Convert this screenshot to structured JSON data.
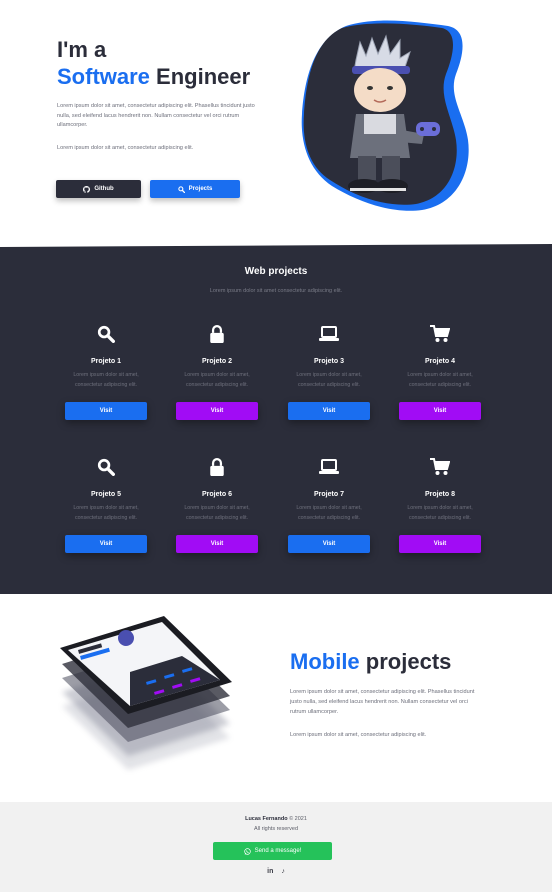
{
  "hero": {
    "title_line1": "I'm a",
    "title_accent": "Software",
    "title_rest": "Engineer",
    "paragraph1": "Lorem ipsum dolor sit amet, consectetur adipiscing elit. Phasellus tincidunt justo nulla, sed eleifend lacus hendrerit non. Nullam consectetur vel orci rutrum ullamcorper.",
    "paragraph2": "Lorem ipsum dolor sit amet, consectetur adipiscing elit.",
    "github_label": "Github",
    "projects_label": "Projects"
  },
  "web": {
    "title": "Web projects",
    "subtitle": "Lorem ipsum dolor sit amet consectetur adipiscing elit.",
    "cards": [
      {
        "name": "Projeto 1",
        "desc": "Lorem ipsum dolor sit amet, consectetur adipiscing elit.",
        "button": "Visit",
        "icon": "search-icon",
        "color": "#1a6ef0"
      },
      {
        "name": "Projeto 2",
        "desc": "Lorem ipsum dolor sit amet, consectetur adipiscing elit.",
        "button": "Visit",
        "icon": "lock-icon",
        "color": "#a10cf5"
      },
      {
        "name": "Projeto 3",
        "desc": "Lorem ipsum dolor sit amet, consectetur adipiscing elit.",
        "button": "Visit",
        "icon": "laptop-icon",
        "color": "#1a6ef0"
      },
      {
        "name": "Projeto 4",
        "desc": "Lorem ipsum dolor sit amet, consectetur adipiscing elit.",
        "button": "Visit",
        "icon": "cart-icon",
        "color": "#a10cf5"
      },
      {
        "name": "Projeto 5",
        "desc": "Lorem ipsum dolor sit amet, consectetur adipiscing elit.",
        "button": "Visit",
        "icon": "search-icon",
        "color": "#1a6ef0"
      },
      {
        "name": "Projeto 6",
        "desc": "Lorem ipsum dolor sit amet, consectetur adipiscing elit.",
        "button": "Visit",
        "icon": "lock-icon",
        "color": "#a10cf5"
      },
      {
        "name": "Projeto 7",
        "desc": "Lorem ipsum dolor sit amet, consectetur adipiscing elit.",
        "button": "Visit",
        "icon": "laptop-icon",
        "color": "#1a6ef0"
      },
      {
        "name": "Projeto 8",
        "desc": "Lorem ipsum dolor sit amet, consectetur adipiscing elit.",
        "button": "Visit",
        "icon": "cart-icon",
        "color": "#a10cf5"
      }
    ]
  },
  "mobile": {
    "title_accent": "Mobile",
    "title_rest": "projects",
    "paragraph1": "Lorem ipsum dolor sit amet, consectetur adipiscing elit. Phasellus tincidunt justo nulla, sed eleifend lacus hendrerit non. Nullam consectetur vel orci rutrum ullamcorper.",
    "paragraph2": "Lorem ipsum dolor sit amet, consectetur adipiscing elit."
  },
  "footer": {
    "author": "Lucas Fernando",
    "copyright": "© 2021",
    "rights": "All rights reserved",
    "message_button": "Send a message!",
    "social_linkedin": "in",
    "social_tiktok": "♪"
  },
  "colors": {
    "accent_blue": "#1a6ef0",
    "accent_purple": "#a10cf5",
    "dark": "#2b2d3a",
    "whatsapp_green": "#25c25a"
  }
}
